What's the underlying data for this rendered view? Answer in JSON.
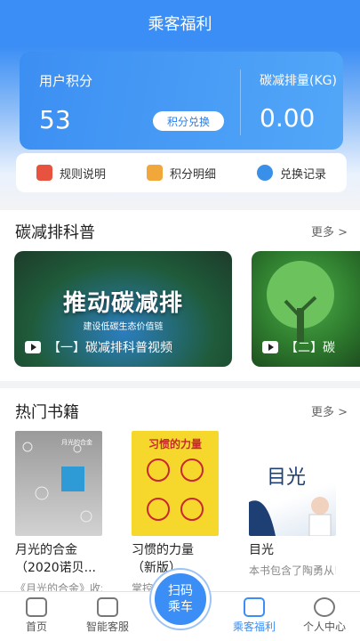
{
  "header": {
    "title": "乘客福利"
  },
  "points": {
    "label": "用户积分",
    "value": "53",
    "redeem_label": "积分兑换",
    "carbon_label": "碳减排量(KG)",
    "carbon_value": "0.00"
  },
  "quick_links": [
    {
      "label": "规则说明",
      "icon": "rules-icon"
    },
    {
      "label": "积分明细",
      "icon": "detail-icon"
    },
    {
      "label": "兑换记录",
      "icon": "record-icon"
    }
  ],
  "science": {
    "title": "碳减排科普",
    "more": "更多 >",
    "videos": [
      {
        "headline": "推动碳减排",
        "sub": "建设低碳生态价值链",
        "caption": "【一】碳减排科普视频"
      },
      {
        "caption": "【二】碳"
      }
    ]
  },
  "books": {
    "title": "热门书籍",
    "more": "更多 >",
    "items": [
      {
        "title_line1": "月光的合金",
        "title_line2": "（2020诺贝...",
        "desc": "《月光的合金》收:",
        "cover_text": "月光的合金"
      },
      {
        "title_line1": "习惯的力量",
        "title_line2": "（新版）",
        "desc": "掌控习",
        "cover_text": "习惯的力量"
      },
      {
        "title_line1": "目光",
        "title_line2": "",
        "desc": "本书包含了陶勇从!",
        "cover_text": "目光"
      }
    ]
  },
  "tabbar": {
    "items": [
      {
        "label": "首页",
        "icon": "home-icon"
      },
      {
        "label": "智能客服",
        "icon": "robot-icon"
      },
      {
        "label": "乘客福利",
        "icon": "gift-icon"
      },
      {
        "label": "个人中心",
        "icon": "user-icon"
      }
    ],
    "scan_line1": "扫码",
    "scan_line2": "乘车"
  }
}
